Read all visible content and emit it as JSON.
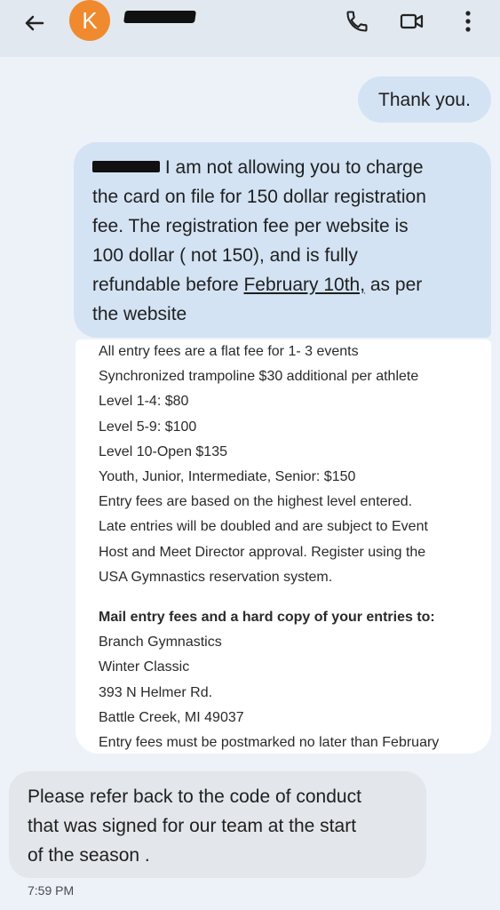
{
  "header": {
    "avatar_letter": "K",
    "contact_name": "",
    "icons": [
      "back-arrow-icon",
      "phone-icon",
      "video-icon",
      "more-vert-icon"
    ],
    "avatar_color": "#f08a2e"
  },
  "messages": {
    "sent_thanks": "Thank you.",
    "sent_main": {
      "line1": "I am not allowing you to charge",
      "line2": "the card on file for 150 dollar registration",
      "line3": "fee. The registration fee per website is",
      "line4": "100 dollar ( not 150), and is fully",
      "line5_pre": "refundable before ",
      "line5_link": "February 10th,",
      "line5_post": " as per",
      "line6": "the website"
    },
    "image_doc": {
      "lines": [
        "All entry fees are a flat fee for 1- 3 events",
        "Synchronized trampoline $30 additional per athlete",
        "Level 1-4: $80",
        "Level 5-9: $100",
        "Level 10-Open $135",
        "Youth, Junior, Intermediate, Senior: $150",
        "Entry fees are based on the highest level entered.",
        "Late entries will be doubled and are subject to Event",
        "Host and Meet Director approval. Register using the",
        "USA Gymnastics reservation system."
      ],
      "mail_heading": "Mail entry fees and a hard copy of your entries to:",
      "address": [
        "Branch Gymnastics",
        "Winter Classic",
        "393 N Helmer Rd.",
        "Battle Creek, MI 49037",
        "Entry fees must be postmarked no later than February"
      ]
    },
    "received_reply": {
      "line1": "Please refer back to the code of conduct",
      "line2": "that was signed for our team at the start",
      "line3": "of the season ."
    },
    "timestamp": "7:59 PM"
  }
}
